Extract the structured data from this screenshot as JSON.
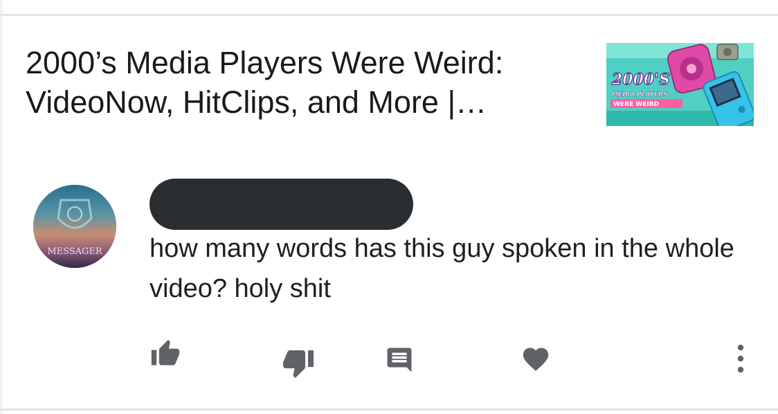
{
  "video": {
    "title": "2000’s Media Players Were Weird: VideoNow, HitClips, and More |…",
    "thumbnail_text": [
      "2000'S",
      "MEDIA PLAYERS",
      "WERE WEIRD"
    ]
  },
  "comment": {
    "author_redacted": true,
    "avatar_text": "MESSAGER",
    "text": "how many words has this guy spoken in the whole video? holy shit"
  },
  "actions": [
    {
      "name": "like",
      "icon": "thumbs-up-icon"
    },
    {
      "name": "dislike",
      "icon": "thumbs-down-icon"
    },
    {
      "name": "reply",
      "icon": "comment-icon"
    },
    {
      "name": "heart",
      "icon": "heart-icon"
    },
    {
      "name": "more",
      "icon": "more-vert-icon"
    }
  ],
  "colors": {
    "icon_gray": "#5f6368",
    "redaction": "#2b2e31",
    "thumbnail_bg": "#54d4c8"
  }
}
